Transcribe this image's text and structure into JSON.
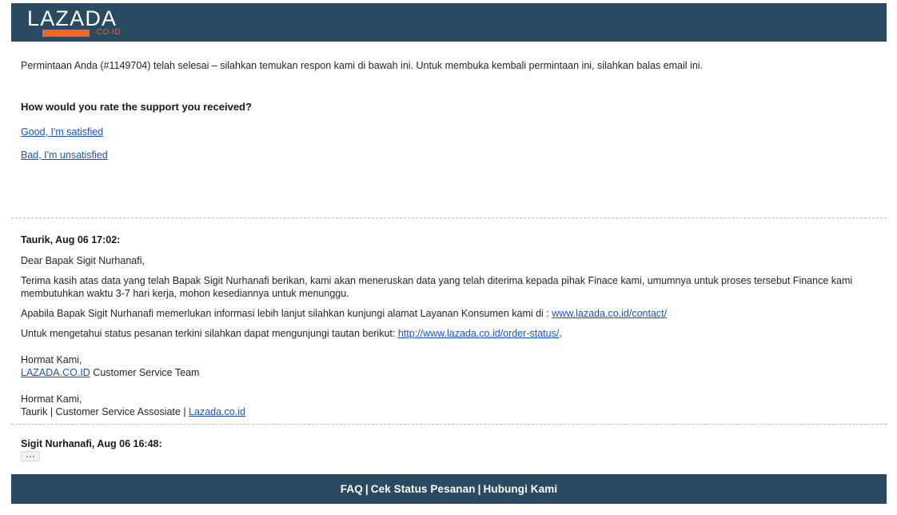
{
  "header": {
    "logo_word": "LAZADA",
    "logo_tld": "·CO·ID",
    "background_color": "#2a4a61",
    "accent_color": "#f26522"
  },
  "intro": {
    "text": "Permintaan Anda (#1149704) telah selesai – silahkan temukan respon kami di bawah ini. Untuk membuka kembali permintaan ini, silahkan balas email ini."
  },
  "rating": {
    "question": "How would you rate the support you received?",
    "options": [
      {
        "label": "Good, I'm satisfied"
      },
      {
        "label": "Bad, I'm unsatisfied"
      }
    ],
    "link_color": "#1a53c4"
  },
  "messages": [
    {
      "header": "Taurik, Aug 06 17:02:",
      "greeting": "Dear Bapak Sigit Nurhanafi,",
      "paragraph_1": "Terima kasih atas data yang telah Bapak Sigit Nurhanafi berikan, kami akan meneruskan data yang telah diterima kepada pihak Finace kami, umumnya untuk proses tersebut Finance kami membutuhkan waktu 3-7 hari kerja, mohon kesediannya untuk menunggu.",
      "paragraph_2_before": "Apabila Bapak Sigit Nurhanafi memerlukan informasi lebih lanjut silahkan kunjungi alamat Layanan Konsumen kami di : ",
      "paragraph_2_link": "www.lazada.co.id/contact/",
      "paragraph_3_before": "Untuk mengetahui status pesanan terkini silahkan dapat mengunjungi tautan berikut: ",
      "paragraph_3_link": "http://www.lazada.co.id/order-status/",
      "paragraph_3_after": ".",
      "signature_1_line_1": "Hormat Kami,",
      "signature_1_link": "LAZADA.CO.ID",
      "signature_1_line_2_after": " Customer Service Team",
      "signature_2_line_1": "Hormat Kami,",
      "signature_2_line_2_before": "Taurik | Customer Service Assosiate | ",
      "signature_2_link": "Lazada.co.id"
    },
    {
      "header": "Sigit Nurhanafi, Aug 06 16:48:",
      "quote_toggle_label": "..."
    }
  ],
  "footer": {
    "items": [
      {
        "label": "FAQ"
      },
      {
        "label": "Cek Status Pesanan"
      },
      {
        "label": "Hubungi Kami"
      }
    ],
    "separator": "|",
    "background_color": "#2a4a61"
  }
}
